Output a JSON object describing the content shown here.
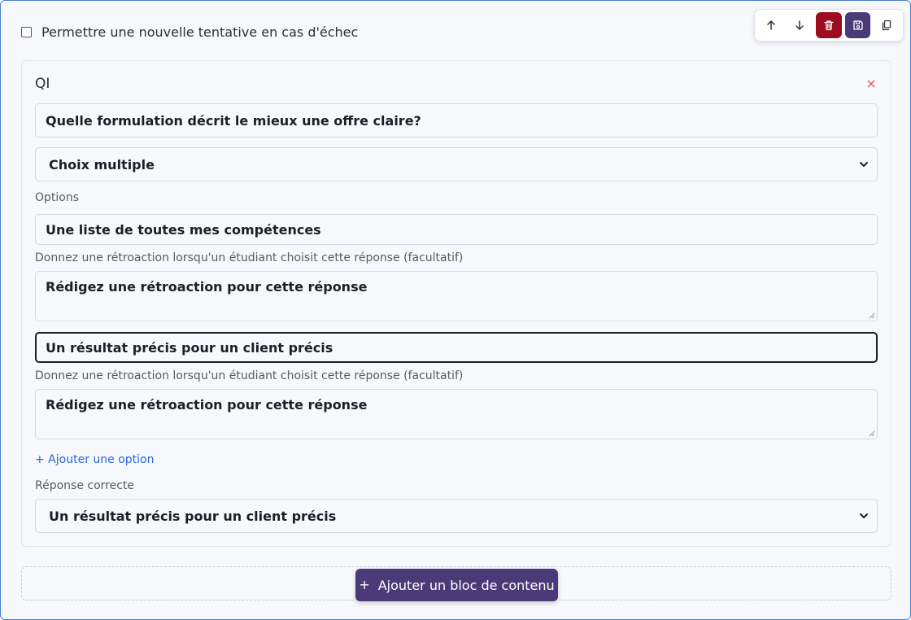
{
  "retry": {
    "label": "Permettre une nouvelle tentative en cas d'échec",
    "checked": false
  },
  "toolbar": {
    "icons": [
      "arrow-up-icon",
      "arrow-down-icon",
      "trash-icon",
      "save-icon",
      "copy-icon"
    ],
    "danger_color": "#9b0d1f",
    "primary_color": "#4a3b78"
  },
  "question": {
    "label": "QI",
    "close_symbol": "×",
    "text": "Quelle formulation décrit le mieux une offre claire?",
    "type": "Choix multiple",
    "options_label": "Options",
    "options": [
      {
        "value": "Une liste de toutes mes compétences",
        "feedback_label": "Donnez une rétroaction lorsqu'un étudiant choisit cette réponse (facultatif)",
        "feedback_placeholder": "Rédigez une rétroaction pour cette réponse"
      },
      {
        "value": "Un résultat précis pour un client précis",
        "feedback_label": "Donnez une rétroaction lorsqu'un étudiant choisit cette réponse (facultatif)",
        "feedback_placeholder": "Rédigez une rétroaction pour cette réponse"
      }
    ],
    "add_option": "+ Ajouter une option",
    "correct_label": "Réponse correcte",
    "correct_value": "Un résultat précis pour un client précis"
  },
  "add_block": {
    "plus": "+",
    "label": "Ajouter un bloc de contenu"
  }
}
